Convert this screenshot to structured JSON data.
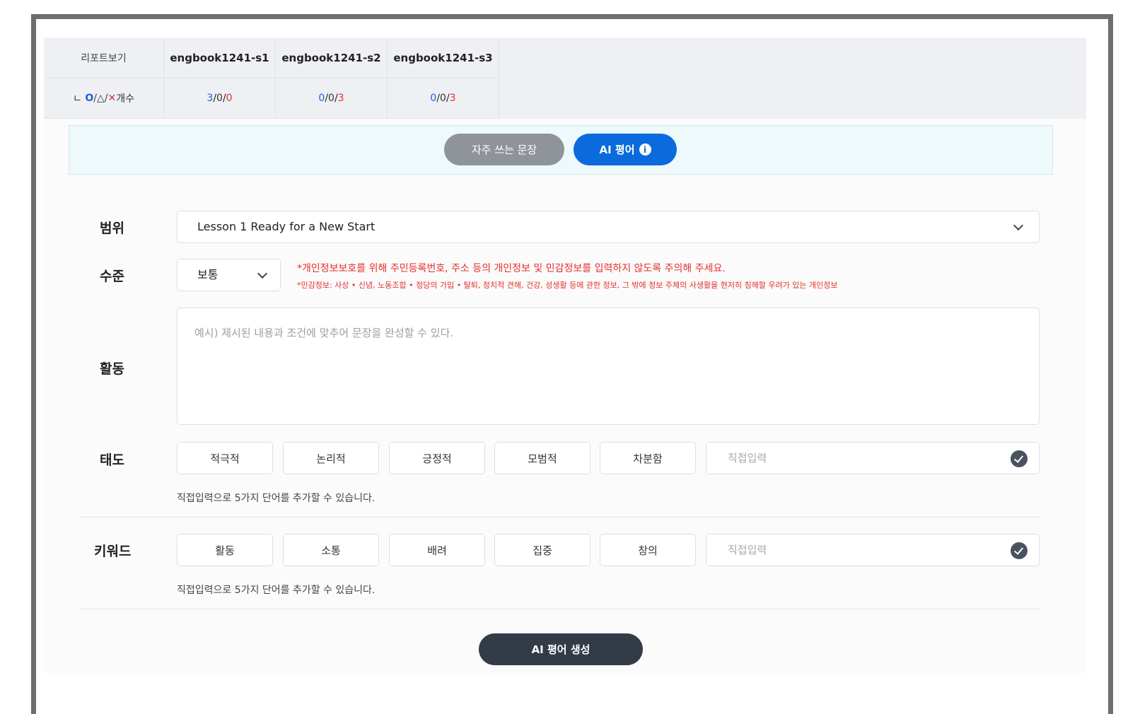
{
  "report": {
    "view_label": "리포트보기",
    "students": [
      "engbook1241-s1",
      "engbook1241-s2",
      "engbook1241-s3"
    ],
    "legend": {
      "prefix": "ㄴ",
      "o": "O",
      "sep1": " / ",
      "tri": "△",
      "sep2": " / ",
      "x": "✕",
      "suffix": " 개수"
    },
    "counts": [
      {
        "o": "3",
        "tri": "0",
        "x": "0"
      },
      {
        "o": "0",
        "tri": "0",
        "x": "3"
      },
      {
        "o": "0",
        "tri": "0",
        "x": "3"
      }
    ]
  },
  "band": {
    "frequent_label": "자주 쓰는 문장",
    "ai_label": "AI 평어",
    "info_icon": "i"
  },
  "form": {
    "range_label": "범위",
    "range_value": "Lesson 1 Ready for a New Start",
    "level_label": "수준",
    "level_value": "보통",
    "notice_main": "*개인정보보호를 위해 주민등록번호, 주소 등의 개인정보 및 민감정보를 입력하지 않도록 주의해 주세요.",
    "notice_sub": "*민감정보: 사상 • 신념, 노동조합 • 정당의 가입 • 탈퇴, 정치적 견해, 건강, 성생활 등에 관한 정보, 그 밖에 정보 주체의 사생활을 현저히 침해할 우려가 있는 개인정보",
    "activity_label": "활동",
    "activity_placeholder": "예시) 제시된 내용과 조건에 맞추어 문장을 완성할 수 있다.",
    "attitude_label": "태도",
    "attitude_chips": [
      "적극적",
      "논리적",
      "긍정적",
      "모범적",
      "차분함"
    ],
    "attitude_direct_placeholder": "직접입력",
    "attitude_hint": "직접입력으로 5가지 단어를 추가할 수 있습니다.",
    "keyword_label": "키워드",
    "keyword_chips": [
      "활동",
      "소통",
      "배려",
      "집중",
      "창의"
    ],
    "keyword_direct_placeholder": "직접입력",
    "keyword_hint": "직접입력으로 5가지 단어를 추가할 수 있습니다.",
    "generate_label": "AI 평어 생성"
  },
  "colors": {
    "accent": "#0c6bdc",
    "o_color": "#1b5fd8",
    "x_color": "#e0322b",
    "dark_button": "#333b47"
  }
}
